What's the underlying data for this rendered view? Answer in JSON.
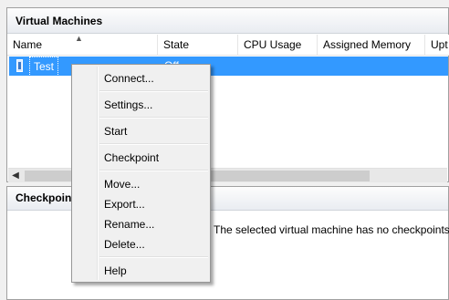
{
  "vm_panel": {
    "title": "Virtual Machines",
    "columns": [
      "Name",
      "State",
      "CPU Usage",
      "Assigned Memory",
      "Upt"
    ],
    "rows": [
      {
        "name": "Test",
        "state": "Off"
      }
    ]
  },
  "checkpoint_panel": {
    "title": "Checkpoints",
    "empty_message": "The selected virtual machine has no checkpoints."
  },
  "context_menu": {
    "items": [
      "Connect...",
      "Settings...",
      "Start",
      "Checkpoint",
      "Move...",
      "Export...",
      "Rename...",
      "Delete...",
      "Help"
    ]
  },
  "colors": {
    "selection": "#3399ff",
    "menu_bg": "#f0f0f0"
  }
}
